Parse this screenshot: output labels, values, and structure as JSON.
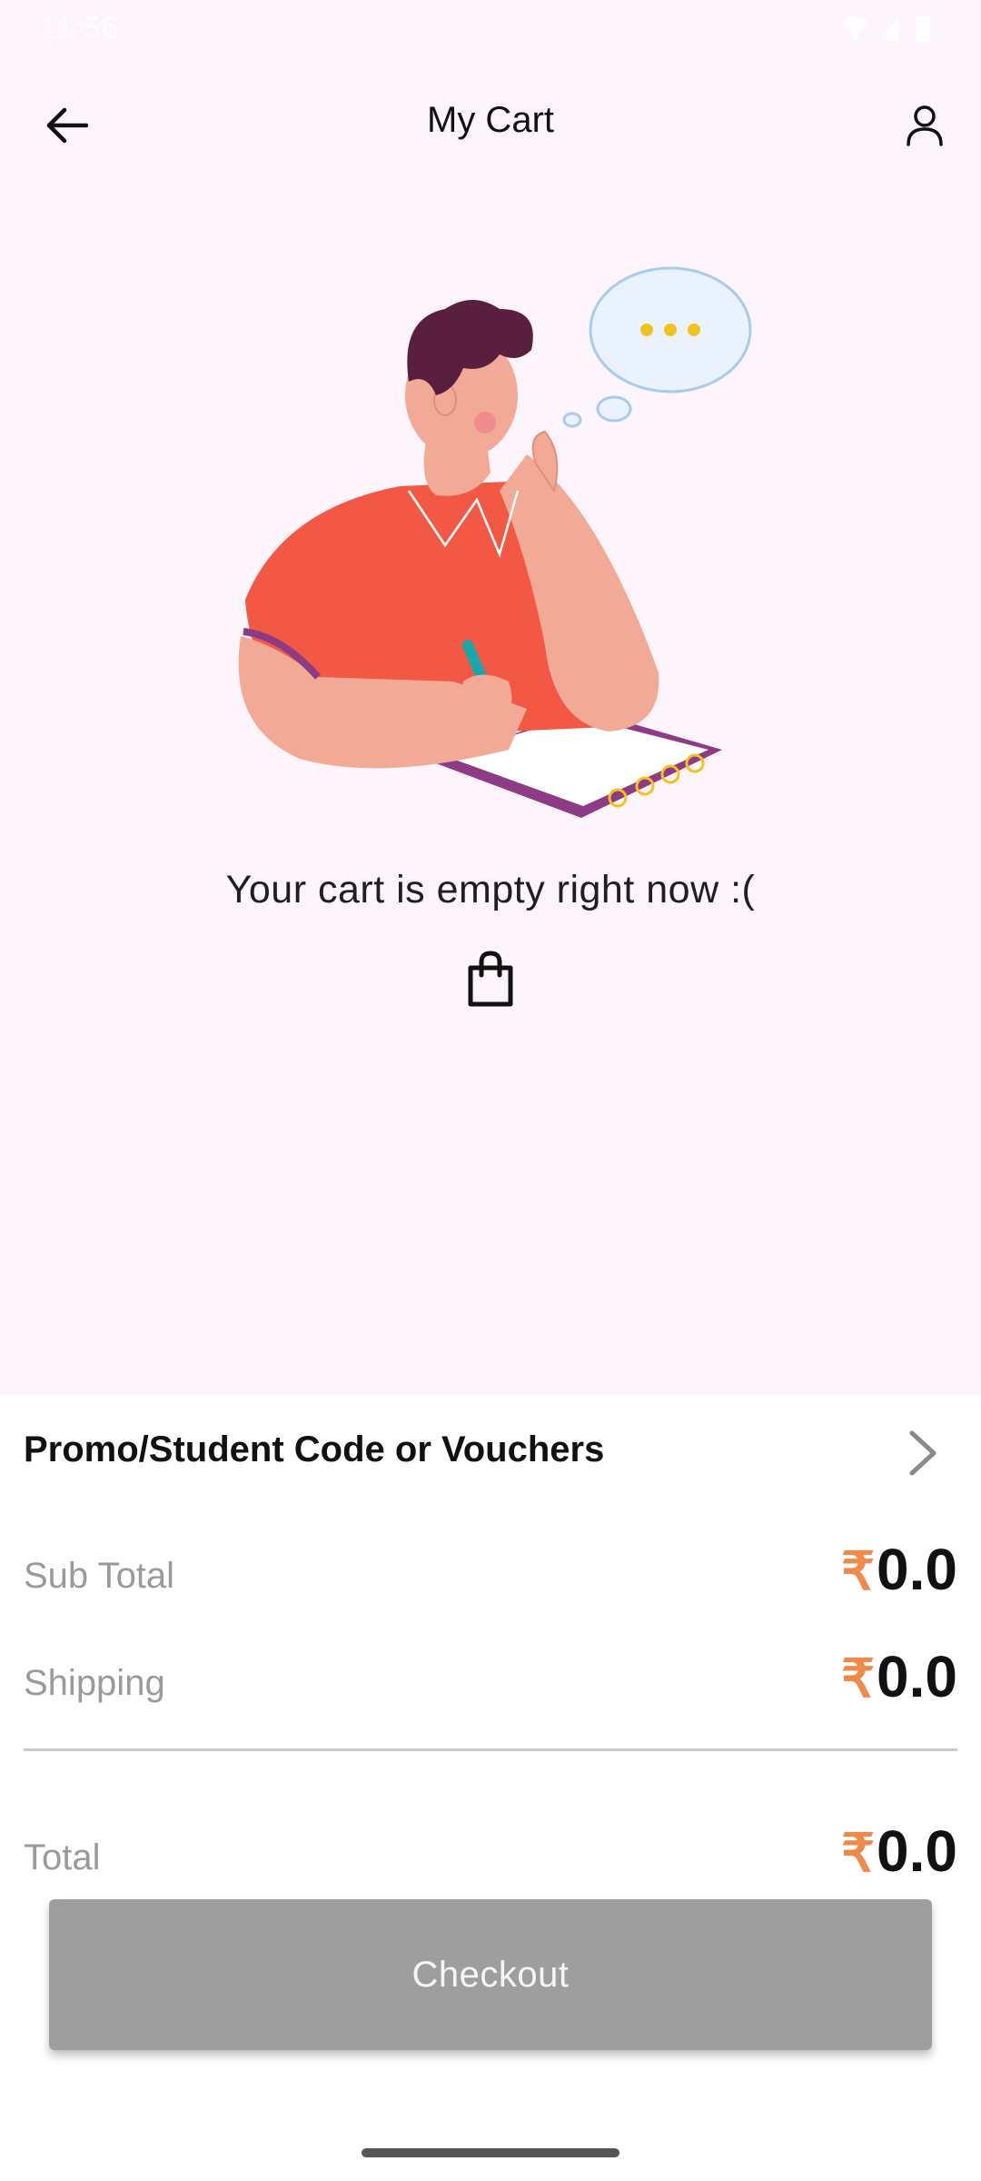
{
  "status_bar": {
    "time": "11:56",
    "icons": [
      "gmail-icon",
      "gmail-icon",
      "wifi-icon",
      "signal-icon",
      "battery-icon"
    ]
  },
  "app_bar": {
    "title": "My Cart",
    "back_icon": "arrow-left-icon",
    "profile_icon": "user-icon"
  },
  "empty_state": {
    "message": "Your cart is empty right now :(",
    "illustration": "thinking-person-illustration",
    "icon": "shopping-bag-icon"
  },
  "promo": {
    "label": "Promo/Student Code or Vouchers",
    "icon": "chevron-right-icon"
  },
  "summary": {
    "currency": "₹",
    "sub_total_label": "Sub Total",
    "sub_total_value": "0.0",
    "shipping_label": "Shipping",
    "shipping_value": "0.0",
    "total_label": "Total",
    "total_value": "0.0"
  },
  "checkout": {
    "label": "Checkout"
  },
  "colors": {
    "page_bg": "#fdf4fc",
    "rupee": "#f08a4b",
    "checkout_disabled": "#9e9e9e"
  }
}
